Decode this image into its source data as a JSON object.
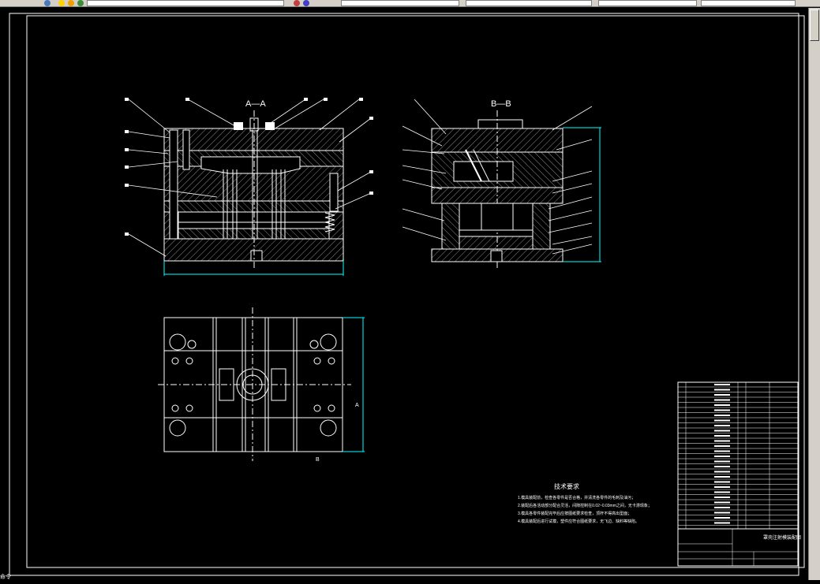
{
  "app": {
    "toolbar_layer_value": "",
    "toolbar_style_value": "",
    "status_text": "命令"
  },
  "drawing": {
    "section_aa_title": "A—A",
    "section_bb_title": "B—B",
    "plan_mark_a": "A",
    "plan_mark_b": "B",
    "tech_requirements_title": "技术要求",
    "tech_requirements_lines": [
      "1.模具装配前，检查各零件是否合格，并清洗各零件的毛刺及油污；",
      "2.装配后各活动部分配合灵活，间隙控制在0.02~0.03mm之间，无卡滞现象；",
      "3.模具各零件装配完毕后应按图纸要求检查，顶杆不得高出型面；",
      "4.模具装配后进行试模，塑件应符合图纸要求，无飞边、缺料等缺陷。"
    ],
    "title_block_name": "罩壳注射模装配图",
    "colors": {
      "outline": "#ffffff",
      "hatch": "#9a9a9a",
      "dimension": "#00ffff",
      "title_block": "#ffffff"
    }
  }
}
